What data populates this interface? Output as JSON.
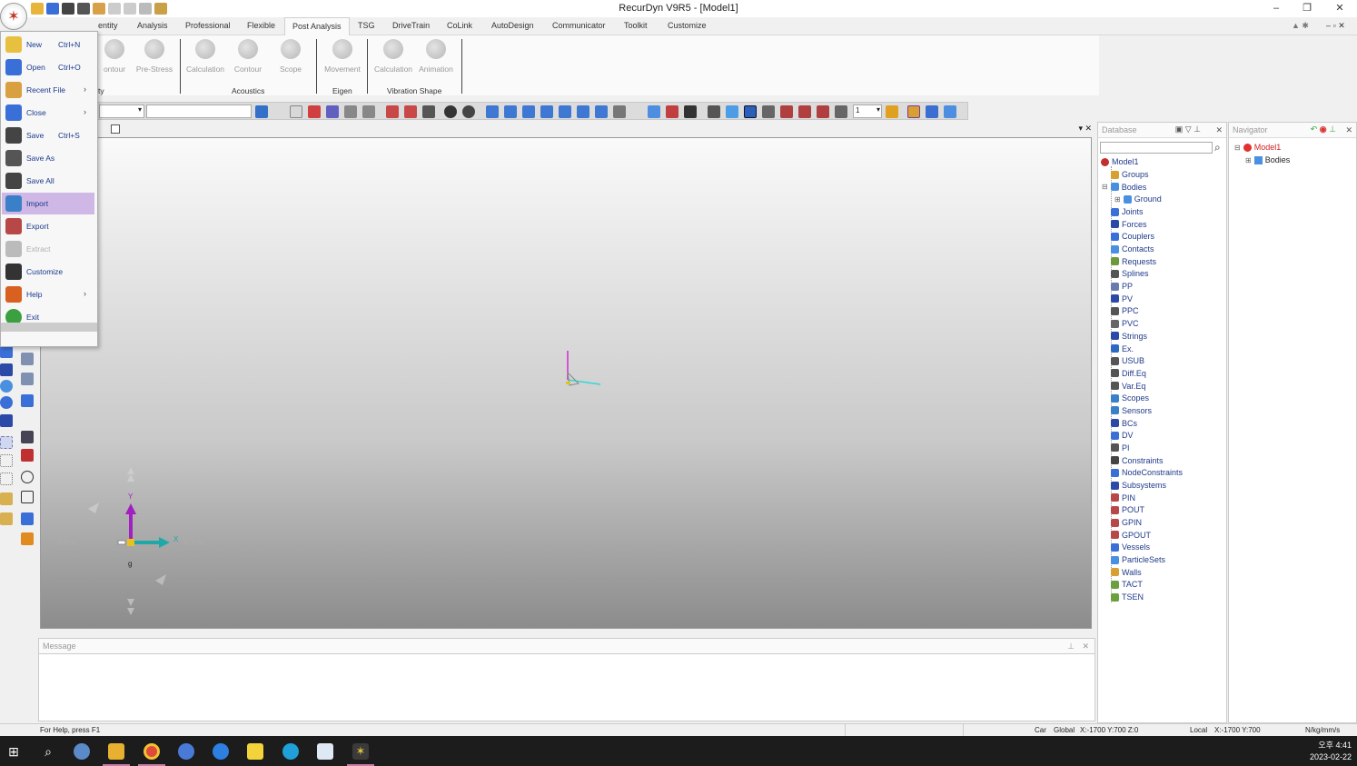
{
  "app": {
    "title": "RecurDyn V9R5  - [Model1]",
    "win_min": "–",
    "win_restore": "❐",
    "win_close": "✕",
    "mdi_buttons": "– ▫ ✕"
  },
  "ribbon": {
    "tabs": [
      "entity",
      "Analysis",
      "Professional",
      "Flexible",
      "Post Analysis",
      "TSG",
      "DriveTrain",
      "CoLink",
      "AutoDesign",
      "Communicator",
      "Toolkit",
      "Customize"
    ],
    "buttons": [
      "ontour",
      "Pre-Stress",
      "Calculation",
      "Contour",
      "Scope",
      "Movement",
      "Calculation",
      "Animation"
    ],
    "groups": [
      "ty",
      "Acoustics",
      "Eigen",
      "Vibration Shape"
    ]
  },
  "toolbar": {
    "zoom_value": "1"
  },
  "app_menu": {
    "items": [
      {
        "label": "New",
        "shortcut": "Ctrl+N"
      },
      {
        "label": "Open",
        "shortcut": "Ctrl+O"
      },
      {
        "label": "Recent File",
        "arrow": "›"
      },
      {
        "label": "Close",
        "arrow": "›"
      },
      {
        "label": "Save",
        "shortcut": "Ctrl+S"
      },
      {
        "label": "Save As"
      },
      {
        "label": "Save All"
      },
      {
        "label": "Import"
      },
      {
        "label": "Export"
      },
      {
        "label": "Extract"
      },
      {
        "label": "Customize"
      },
      {
        "label": "Help",
        "arrow": "›"
      },
      {
        "label": "Exit"
      }
    ]
  },
  "viewport": {
    "triad": {
      "x": "X",
      "y": "Y",
      "g": "g"
    },
    "rewind": "◀◀◀",
    "forward": "▶▶▶"
  },
  "message": {
    "title": "Message",
    "pin": "⊥",
    "close": "✕"
  },
  "database": {
    "title": "Database",
    "close": "✕",
    "root": "Model1",
    "items": [
      "Groups",
      "Bodies",
      "Ground",
      "Joints",
      "Forces",
      "Couplers",
      "Contacts",
      "Requests",
      "Splines",
      "PP",
      "PV",
      "PPC",
      "PVC",
      "Strings",
      "Ex.",
      "USUB",
      "Diff.Eq",
      "Var.Eq",
      "Scopes",
      "Sensors",
      "BCs",
      "DV",
      "PI",
      "Constraints",
      "NodeConstraints",
      "Subsystems",
      "PIN",
      "POUT",
      "GPIN",
      "GPOUT",
      "Vessels",
      "ParticleSets",
      "Walls",
      "TACT",
      "TSEN"
    ]
  },
  "navigator": {
    "title": "Navigator",
    "close": "✕",
    "root": "Model1",
    "child": "Bodies"
  },
  "status": {
    "help": "For Help, press F1",
    "car": "Car",
    "global": "Global",
    "global_xy": "X:-1700 Y:700 Z:0",
    "local": "Local",
    "local_xy": "X:-1700 Y:700",
    "units": "N/kg/mm/s"
  },
  "taskbar": {
    "time": "오후 4:41",
    "date": "2023-02-22"
  }
}
